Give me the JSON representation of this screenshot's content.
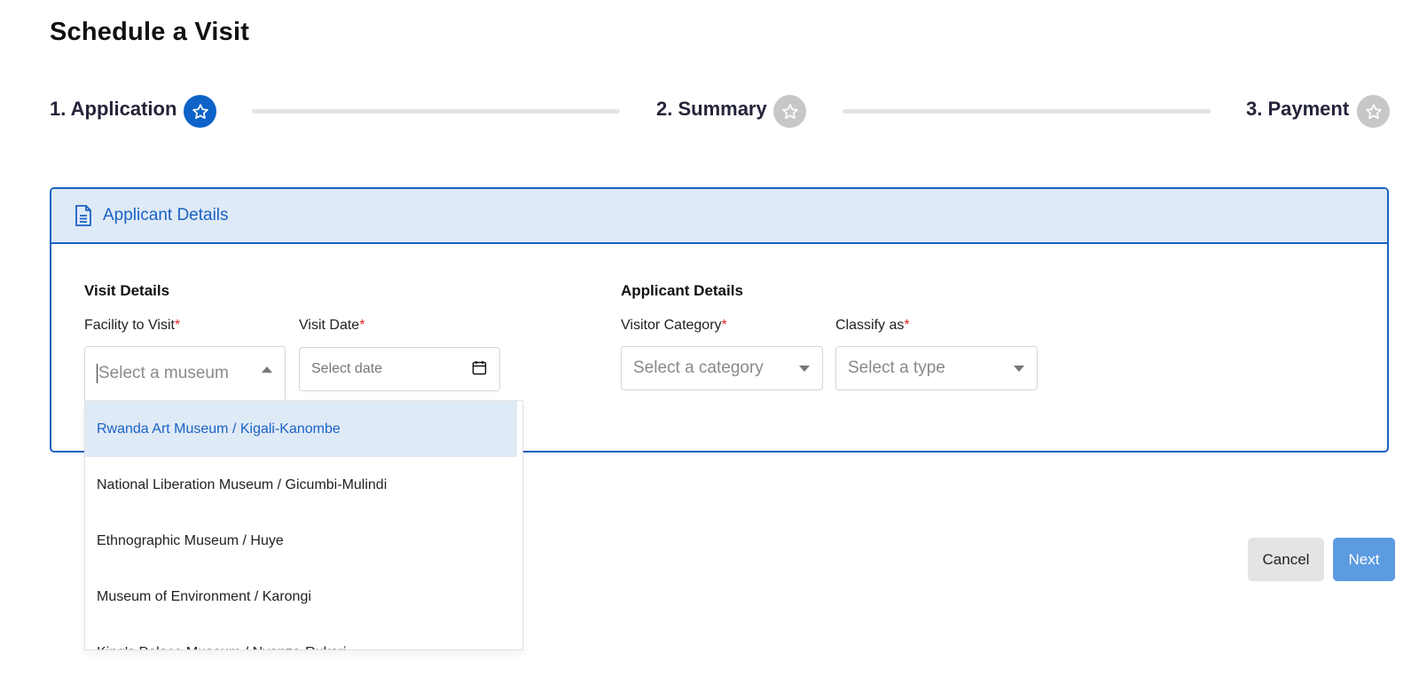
{
  "page": {
    "title": "Schedule a Visit"
  },
  "stepper": {
    "steps": [
      {
        "label": "1. Application",
        "state": "active",
        "icon": "star-icon"
      },
      {
        "label": "2. Summary",
        "state": "inactive",
        "icon": "star-icon"
      },
      {
        "label": "3. Payment",
        "state": "inactive",
        "icon": "star-icon"
      }
    ]
  },
  "card": {
    "header_title": "Applicant Details",
    "header_icon": "document-icon",
    "visit_section": {
      "title": "Visit Details",
      "facility_label": "Facility to Visit",
      "facility_placeholder": "Select a museum",
      "date_label": "Visit Date",
      "date_placeholder": "Select date"
    },
    "applicant_section": {
      "title": "Applicant Details",
      "category_label": "Visitor Category",
      "category_placeholder": "Select a category",
      "classify_label": "Classify as",
      "classify_placeholder": "Select a type"
    },
    "required_marker": "*"
  },
  "dropdown": {
    "options": [
      "Rwanda Art Museum / Kigali-Kanombe",
      "National Liberation Museum / Gicumbi-Mulindi",
      "Ethnographic Museum / Huye",
      "Museum of Environment / Karongi",
      "King's Palace Museum / Nyanza-Rukari"
    ],
    "highlighted_index": 0
  },
  "actions": {
    "cancel_label": "Cancel",
    "next_label": "Next"
  },
  "colors": {
    "primary": "#1a62c4",
    "active_step": "#0d63c7",
    "inactive_step": "#c7c7c7",
    "next_button": "#5b9be0",
    "required": "#e02424"
  }
}
